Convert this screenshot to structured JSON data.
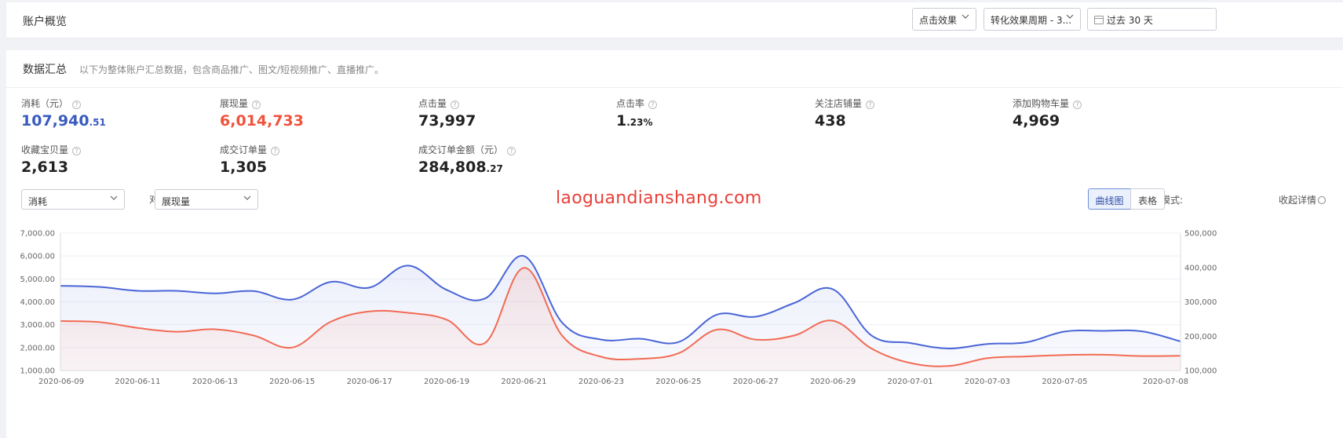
{
  "header": {
    "title": "账户概览",
    "select_effect": "点击效果",
    "select_period": "转化效果周期 - 3...",
    "date_range": "过去 30 天"
  },
  "summary": {
    "title": "数据汇总",
    "description": "以下为整体账户汇总数据，包含商品推广、图文/短视频推广、直播推广。"
  },
  "metrics": [
    {
      "label": "消耗（元）",
      "int": "107,940",
      "frac": ".51",
      "color": "#3a5bbf"
    },
    {
      "label": "展现量",
      "int": "6,014,733",
      "frac": "",
      "color": "#f0533d"
    },
    {
      "label": "点击量",
      "int": "73,997",
      "frac": "",
      "color": "#222222"
    },
    {
      "label": "点击率",
      "int": "1",
      "frac": ".23%",
      "color": "#222222"
    },
    {
      "label": "关注店铺量",
      "int": "438",
      "frac": "",
      "color": "#222222"
    },
    {
      "label": "添加购物车量",
      "int": "4,969",
      "frac": "",
      "color": "#222222"
    },
    {
      "label": "收藏宝贝量",
      "int": "2,613",
      "frac": "",
      "color": "#222222"
    },
    {
      "label": "成交订单量",
      "int": "1,305",
      "frac": "",
      "color": "#222222"
    },
    {
      "label": "成交订单金额（元）",
      "int": "284,808",
      "frac": ".27",
      "color": "#222222"
    }
  ],
  "controls": {
    "metric_a": "消耗",
    "vs_label": "对比",
    "metric_b": "展现量",
    "watermark": "laoguandianshang.com",
    "mode_label": "显示模式:",
    "mode_curve": "曲线图",
    "mode_table": "表格",
    "collapse": "收起详情"
  },
  "chart_data": {
    "type": "line",
    "x": [
      "2020-06-09",
      "2020-06-10",
      "2020-06-11",
      "2020-06-12",
      "2020-06-13",
      "2020-06-14",
      "2020-06-15",
      "2020-06-16",
      "2020-06-17",
      "2020-06-18",
      "2020-06-19",
      "2020-06-20",
      "2020-06-21",
      "2020-06-22",
      "2020-06-23",
      "2020-06-24",
      "2020-06-25",
      "2020-06-26",
      "2020-06-27",
      "2020-06-28",
      "2020-06-29",
      "2020-06-30",
      "2020-07-01",
      "2020-07-02",
      "2020-07-03",
      "2020-07-04",
      "2020-07-05",
      "2020-07-06",
      "2020-07-07",
      "2020-07-08"
    ],
    "x_tick_labels": [
      "2020-06-09",
      "2020-06-11",
      "2020-06-13",
      "2020-06-15",
      "2020-06-17",
      "2020-06-19",
      "2020-06-21",
      "2020-06-23",
      "2020-06-25",
      "2020-06-27",
      "2020-06-29",
      "2020-07-01",
      "2020-07-03",
      "2020-07-05",
      "2020-07-08"
    ],
    "series": [
      {
        "axis": "left",
        "color": "#4a65d6",
        "values": [
          4700,
          4650,
          4480,
          4480,
          4370,
          4470,
          4100,
          4870,
          4620,
          5580,
          4520,
          4150,
          6000,
          3070,
          2350,
          2390,
          2240,
          3440,
          3350,
          3950,
          4550,
          2530,
          2200,
          1960,
          2160,
          2230,
          2700,
          2730,
          2710,
          2270
        ]
      },
      {
        "axis": "right",
        "color": "#f26b55",
        "values": [
          244000,
          241000,
          224000,
          213000,
          220000,
          202000,
          167000,
          242000,
          272000,
          268000,
          248000,
          181000,
          399000,
          200000,
          140000,
          134000,
          150000,
          219000,
          190000,
          202000,
          245000,
          164000,
          122000,
          113000,
          136000,
          141000,
          145000,
          146000,
          142000,
          143000
        ]
      }
    ],
    "y_left": {
      "min": 1000,
      "max": 7000,
      "ticks": [
        "1,000.00",
        "2,000.00",
        "3,000.00",
        "4,000.00",
        "5,000.00",
        "6,000.00",
        "7,000.00"
      ]
    },
    "y_right": {
      "min": 100000,
      "max": 500000,
      "ticks": [
        "100,000",
        "200,000",
        "300,000",
        "400,000",
        "500,000"
      ]
    },
    "grid": true
  }
}
